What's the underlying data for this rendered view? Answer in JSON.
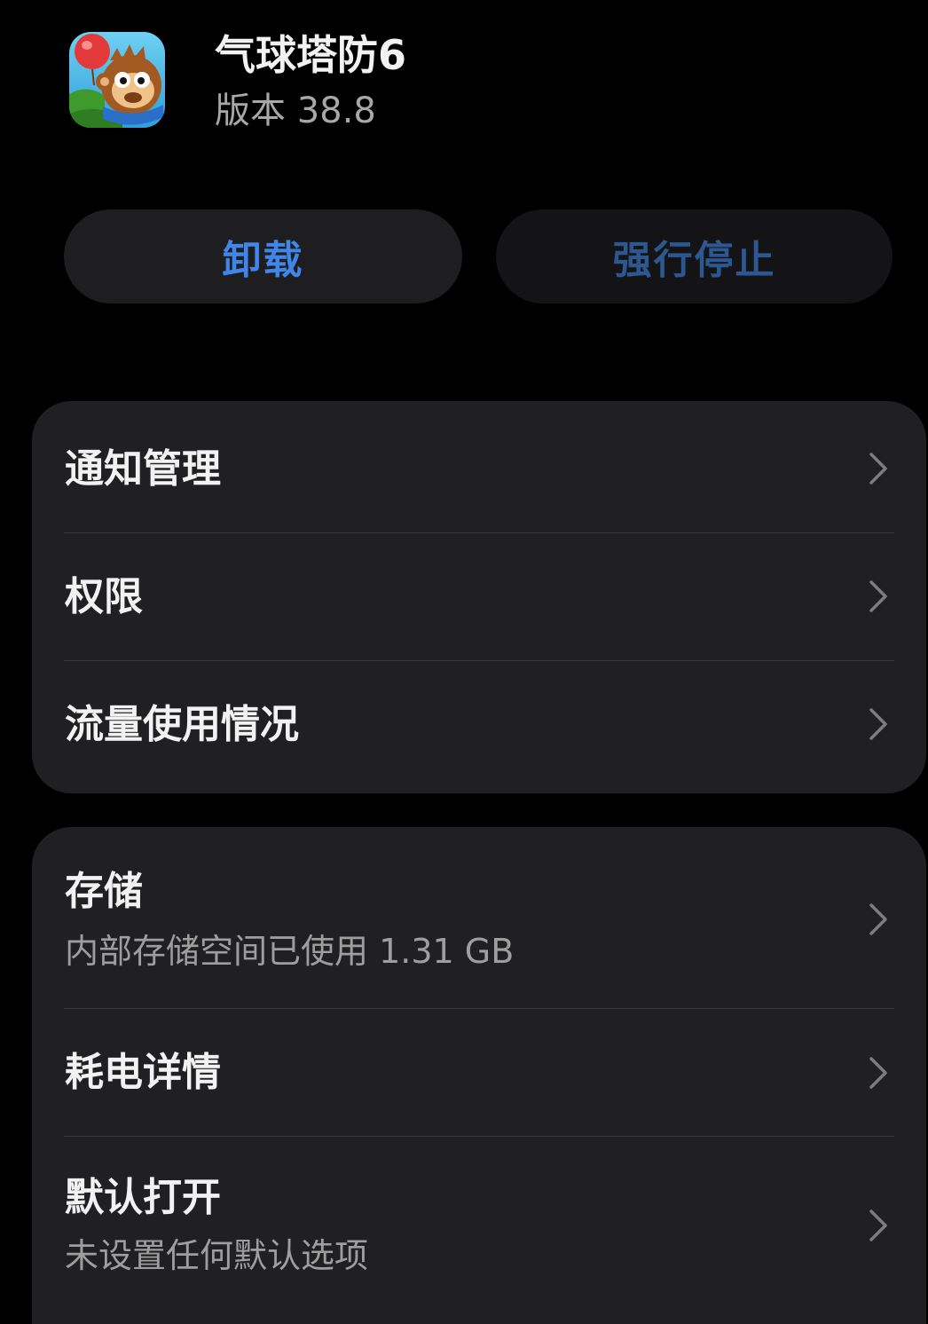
{
  "app": {
    "name": "气球塔防6",
    "version": "版本 38.8",
    "icon": "bloons-td6-monkey-icon"
  },
  "actions": {
    "uninstall_label": "卸载",
    "force_stop_label": "强行停止"
  },
  "section_1": {
    "items": [
      {
        "label": "通知管理",
        "icon": "chevron-right-icon"
      },
      {
        "label": "权限",
        "icon": "chevron-right-icon"
      },
      {
        "label": "流量使用情况",
        "icon": "chevron-right-icon"
      }
    ]
  },
  "section_2": {
    "items": [
      {
        "label": "存储",
        "subtitle": "内部存储空间已使用 1.31 GB",
        "icon": "chevron-right-icon"
      },
      {
        "label": "耗电详情",
        "icon": "chevron-right-icon"
      },
      {
        "label": "默认打开",
        "subtitle": "未设置任何默认选项",
        "icon": "chevron-right-icon"
      }
    ]
  },
  "colors": {
    "background": "#000000",
    "card": "#202022",
    "accent": "#3f86e8",
    "accent_disabled": "#2c5791",
    "text_primary": "#f2f2f2",
    "text_secondary": "#9e9e9e"
  }
}
